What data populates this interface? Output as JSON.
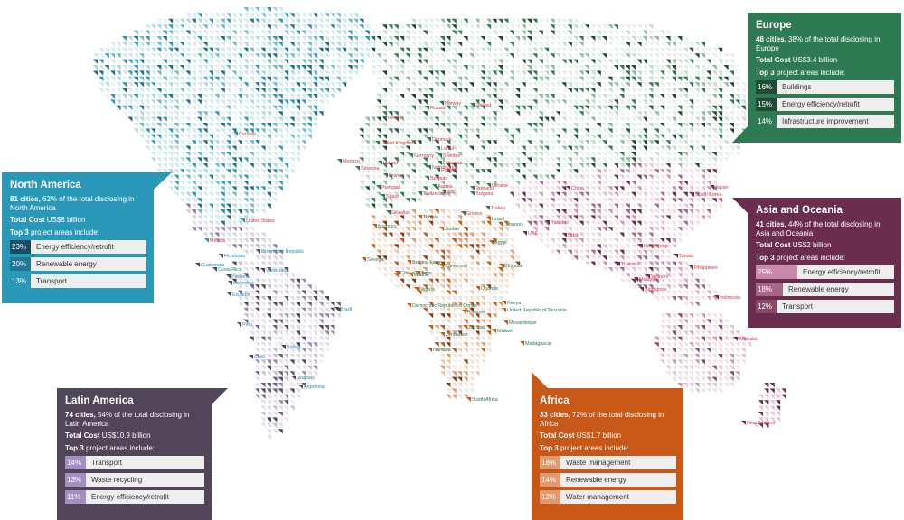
{
  "colors": {
    "europe": "#2e7a52",
    "north_america": "#2a99b9",
    "asia_oceania": "#6a2d4d",
    "latin_america": "#524459",
    "africa": "#c85817",
    "label_red": "#d83a4f",
    "label_blue": "#2a8fb3",
    "label_green": "#2e7a52"
  },
  "panels": {
    "europe": {
      "title": "Europe",
      "cities": "48 cities,",
      "share": " 38% of the total disclosing in Europe",
      "cost_label": "Total Cost",
      "cost_value": " US$3.4 billion",
      "top3": "Top 3 project areas include:",
      "items": [
        {
          "pct": "16%",
          "label": "Buildings"
        },
        {
          "pct": "15%",
          "label": "Energy efficiency/retrofit"
        },
        {
          "pct": "14%",
          "label": "Infrastructure improvement"
        }
      ]
    },
    "north_america": {
      "title": "North America",
      "cities": "81 cities,",
      "share": " 62% of the total disclosing in North America",
      "cost_label": "Total Cost",
      "cost_value": " US$8 billion",
      "top3": "Top 3 project areas include:",
      "items": [
        {
          "pct": "23%",
          "label": "Energy efficiency/retrofit"
        },
        {
          "pct": "20%",
          "label": "Renewable energy"
        },
        {
          "pct": "13%",
          "label": "Transport"
        }
      ]
    },
    "asia_oceania": {
      "title": "Asia and Oceania",
      "cities": "41 cities,",
      "share": " 44% of the total disclosing in Asia and Oceania",
      "cost_label": "Total Cost",
      "cost_value": " US$2 billion",
      "top3": "Top 3 project areas include:",
      "items": [
        {
          "pct": "25%",
          "label": "Energy efficiency/retrofit"
        },
        {
          "pct": "18%",
          "label": "Renewable energy"
        },
        {
          "pct": "12%",
          "label": "Transport"
        }
      ]
    },
    "latin_america": {
      "title": "Latin America",
      "cities": "74 cities,",
      "share": " 54% of the total disclosing in Latin America",
      "cost_label": "Total Cost",
      "cost_value": " US$10.9 billion",
      "top3": "Top 3 project areas include:",
      "items": [
        {
          "pct": "14%",
          "label": "Transport"
        },
        {
          "pct": "13%",
          "label": "Waste recycling"
        },
        {
          "pct": "11%",
          "label": "Energy efficiency/retrofit"
        }
      ]
    },
    "africa": {
      "title": "Africa",
      "cities": "33 cities,",
      "share": " 72% of the total disclosing in Africa",
      "cost_label": "Total Cost",
      "cost_value": " US$1.7 billion",
      "top3": "Top 3 project areas include:",
      "items": [
        {
          "pct": "18%",
          "label": "Waste management"
        },
        {
          "pct": "14%",
          "label": "Renewable energy"
        },
        {
          "pct": "12%",
          "label": "Water management"
        }
      ]
    }
  },
  "labels": {
    "north_america": [
      "Canada",
      "United States",
      "Mexico"
    ],
    "latin_america": [
      "Dominican Republic",
      "Guatemala",
      "Honduras",
      "Costa Rica",
      "Panama",
      "Venezuela",
      "Colombia",
      "Ecuador",
      "Peru",
      "Brazil",
      "Bolivia",
      "Chile",
      "Uruguay",
      "Argentina"
    ],
    "europe": [
      "Iceland",
      "Norway",
      "Finland",
      "Russia",
      "United Kingdom",
      "Denmark",
      "Latvia",
      "Ireland",
      "Germany",
      "Sweden",
      "Lithuania",
      "Monaco",
      "Slovenia",
      "Netherlands",
      "Poland",
      "France",
      "Belgium",
      "Ukraine",
      "Austria",
      "Portugal",
      "Spain",
      "Switzerland",
      "Italy",
      "Romania",
      "Bulgaria",
      "Gibraltar",
      "Greece",
      "Turkey"
    ],
    "africa": [
      "Morocco",
      "Tunisia",
      "Israel",
      "Jordan",
      "Egypt",
      "Senegal",
      "Burkina Faso",
      "Cameroon",
      "Ethiopia",
      "Côte d'Ivoire",
      "Ghana",
      "Togo",
      "Nigeria",
      "Uganda",
      "Kenya",
      "Democratic Republic of Congo",
      "United Republic of Tanzania",
      "Rwanda",
      "Mozambique",
      "Zambia",
      "Malawi",
      "Zimbabwe",
      "Madagascar",
      "Namibia",
      "South Africa",
      "Lebanon"
    ],
    "asia_oceania": [
      "China",
      "South Korea",
      "Japan",
      "Pakistan",
      "India",
      "UAE",
      "Hong Kong",
      "Taiwan",
      "Thailand",
      "Vietnam",
      "Philippines",
      "Malaysia",
      "Singapore",
      "Indonesia",
      "Australia",
      "New Zealand"
    ]
  }
}
